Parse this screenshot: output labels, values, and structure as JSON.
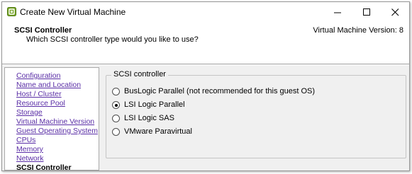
{
  "window": {
    "title": "Create New Virtual Machine",
    "icon": "vsphere-app-icon",
    "controls": {
      "minimize": "minimize-icon",
      "maximize": "maximize-icon",
      "close": "close-icon"
    }
  },
  "header": {
    "title": "SCSI Controller",
    "subtitle": "Which SCSI controller type would you like to use?",
    "version": "Virtual Machine Version: 8"
  },
  "nav": {
    "items": [
      {
        "label": "Configuration",
        "current": false
      },
      {
        "label": "Name and Location",
        "current": false
      },
      {
        "label": "Host / Cluster",
        "current": false
      },
      {
        "label": "Resource Pool",
        "current": false
      },
      {
        "label": "Storage",
        "current": false
      },
      {
        "label": "Virtual Machine Version",
        "current": false
      },
      {
        "label": "Guest Operating System",
        "current": false
      },
      {
        "label": "CPUs",
        "current": false
      },
      {
        "label": "Memory",
        "current": false
      },
      {
        "label": "Network",
        "current": false
      },
      {
        "label": "SCSI Controller",
        "current": true
      }
    ]
  },
  "scsi": {
    "group_label": "SCSI controller",
    "options": [
      {
        "label": "BusLogic Parallel (not recommended for this guest OS)",
        "selected": false
      },
      {
        "label": "LSI Logic Parallel",
        "selected": true
      },
      {
        "label": "LSI Logic SAS",
        "selected": false
      },
      {
        "label": "VMware Paravirtual",
        "selected": false
      }
    ]
  },
  "colors": {
    "link": "#5a2ea6",
    "panel_bg": "#f0f0f0",
    "icon_green": "#7aa62a"
  }
}
